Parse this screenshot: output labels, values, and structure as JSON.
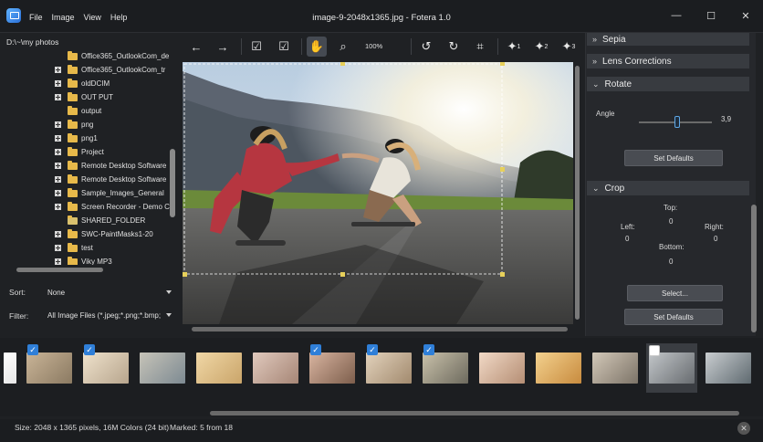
{
  "titlebar": {
    "window_title": "image-9-2048x1365.jpg - Fotera 1.0",
    "menu": [
      "File",
      "Image",
      "View",
      "Help"
    ],
    "minimize_glyph": "—",
    "maximize_glyph": "☐",
    "close_glyph": "✕"
  },
  "browser": {
    "path": "D:\\~\\my photos",
    "folders": [
      {
        "label": "Office365_OutlookCom_de",
        "expandable": false
      },
      {
        "label": "Office365_OutlookCom_tr",
        "expandable": true
      },
      {
        "label": "oldDCIM",
        "expandable": true
      },
      {
        "label": "OUT PUT",
        "expandable": true
      },
      {
        "label": "output",
        "expandable": false
      },
      {
        "label": "png",
        "expandable": true
      },
      {
        "label": "png1",
        "expandable": true
      },
      {
        "label": "Project",
        "expandable": true
      },
      {
        "label": "Remote Desktop Software",
        "expandable": true
      },
      {
        "label": "Remote Desktop Software",
        "expandable": true
      },
      {
        "label": "Sample_Images_General",
        "expandable": true
      },
      {
        "label": "Screen Recorder - Demo C",
        "expandable": true
      },
      {
        "label": "SHARED_FOLDER",
        "expandable": false,
        "shared": true
      },
      {
        "label": "SWC-PaintMasks1-20",
        "expandable": true
      },
      {
        "label": "test",
        "expandable": true
      },
      {
        "label": "Viky MP3",
        "expandable": true
      }
    ],
    "sort_label": "Sort:",
    "sort_value": "None",
    "filter_label": "Filter:",
    "filter_value": "All Image Files (*.jpeg;*.png;*.bmp;"
  },
  "toolbar": {
    "back_icon": "←",
    "forward_icon": "→",
    "mark_icon": "☑",
    "mark_all_icon": "☑",
    "hand_icon": "✋",
    "zoom_icon": "⌕",
    "zoom_level": "100%",
    "rotate_left_icon": "↺",
    "rotate_right_icon": "↻",
    "crop_icon": "⌗",
    "wand1_sub": "1",
    "wand2_sub": "2",
    "wand3_sub": "3",
    "wand_glyph": "✦"
  },
  "panel": {
    "sepia": "Sepia",
    "lens": "Lens Corrections",
    "rotate": "Rotate",
    "angle_label": "Angle",
    "angle_value": "3,9",
    "angle_fraction": 0.5,
    "set_defaults": "Set Defaults",
    "crop": "Crop",
    "top_label": "Top:",
    "top_value": "0",
    "left_label": "Left:",
    "left_value": "0",
    "right_label": "Right:",
    "right_value": "0",
    "bottom_label": "Bottom:",
    "bottom_value": "0",
    "select_button": "Select...",
    "set_defaults_2": "Set Defaults"
  },
  "status": {
    "size": "Size: 2048 x 1365 pixels, 16M Colors (24 bit)",
    "marked": "Marked: 5 from 18",
    "clear_glyph": "✕"
  },
  "colors": {
    "accent": "#2f7fd8",
    "folder": "#e7b94a",
    "panel_header": "#383b40",
    "background": "#1f2124"
  }
}
